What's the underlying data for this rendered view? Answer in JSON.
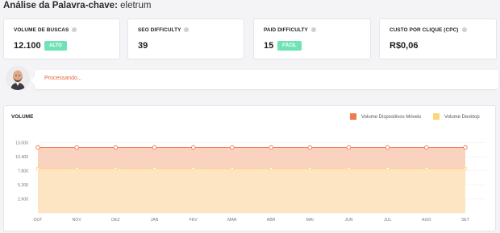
{
  "header": {
    "title_bold": "Análise da Palavra-chave:",
    "keyword": "eletrum"
  },
  "metrics": [
    {
      "label": "VOLUME DE BUSCAS",
      "value": "12.100",
      "badge": "ALTO"
    },
    {
      "label": "SEO DIFFICULTY",
      "value": "39"
    },
    {
      "label": "PAID DIFFICULTY",
      "value": "15",
      "badge": "FÁCIL"
    },
    {
      "label": "CUSTO POR CLIQUE (CPC)",
      "value": "R$0,06"
    }
  ],
  "status": {
    "message": "Processando..."
  },
  "chart_data": {
    "type": "area",
    "title": "VOLUME",
    "categories": [
      "OUT",
      "NOV",
      "DEZ",
      "JAN",
      "FEV",
      "MAR",
      "ABR",
      "MAI",
      "JUN",
      "JUL",
      "AGO",
      "SET"
    ],
    "ylim": [
      0,
      15600
    ],
    "yticks": [
      2600,
      5200,
      7800,
      10400,
      13000
    ],
    "ytick_labels": [
      "2.600",
      "5.200",
      "7.800",
      "10.400",
      "13.000"
    ],
    "series": [
      {
        "name": "Volume Dispositivos Móveis",
        "color": "#f07a4e",
        "fill": "#f9cbb5",
        "values": [
          12100,
          12100,
          12100,
          12100,
          12100,
          12100,
          12100,
          12100,
          12100,
          12100,
          12100,
          12100
        ]
      },
      {
        "name": "Volume Desktop",
        "color": "#fcd57b",
        "fill": "#fde6c3",
        "values": [
          8200,
          8200,
          8200,
          8200,
          8200,
          8200,
          8200,
          8200,
          8200,
          8200,
          8200,
          8200
        ]
      }
    ],
    "grid": true,
    "legend_position": "top-right"
  }
}
